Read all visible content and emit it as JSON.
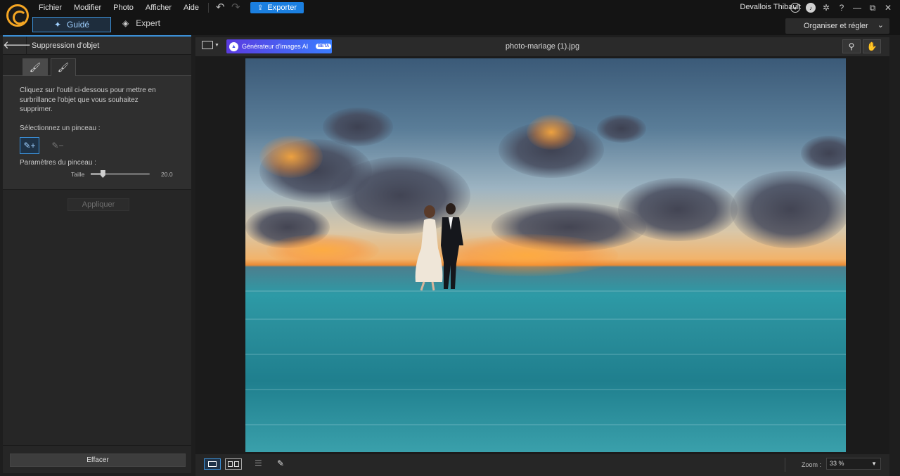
{
  "menu": [
    "Fichier",
    "Modifier",
    "Photo",
    "Afficher",
    "Aide"
  ],
  "toolbar": {
    "undo": "↶",
    "redo": "↷",
    "export_label": "Exporter",
    "export_icon": "export-icon"
  },
  "user": {
    "name": "Devallois Thibault"
  },
  "window_controls": {
    "help": "?",
    "minimize": "—",
    "restore": "⧉",
    "close": "✕"
  },
  "modes": {
    "guide": "Guidé",
    "expert": "Expert",
    "organise": "Organiser et régler"
  },
  "panel": {
    "title": "Suppression d'objet",
    "description": "Cliquez sur l'outil ci-dessous pour mettre en surbrillance l'objet que vous souhaitez supprimer.",
    "brush_label": "Sélectionnez un pinceau :",
    "params_label": "Paramètres du pinceau :",
    "size_label": "Taille",
    "size_value": "20.0",
    "size_fraction": 0.2,
    "apply_label": "Appliquer",
    "clear_label": "Effacer"
  },
  "viewer": {
    "ai_label": "Générateur d'images AI",
    "ai_badge": "BETA",
    "filename": "photo-mariage (1).jpg"
  },
  "bottom": {
    "zoom_label": "Zoom :",
    "zoom_value": "33 %"
  },
  "colors": {
    "accent": "#3b8fd6",
    "export": "#1b7fe0",
    "logo": "#f5a623"
  }
}
